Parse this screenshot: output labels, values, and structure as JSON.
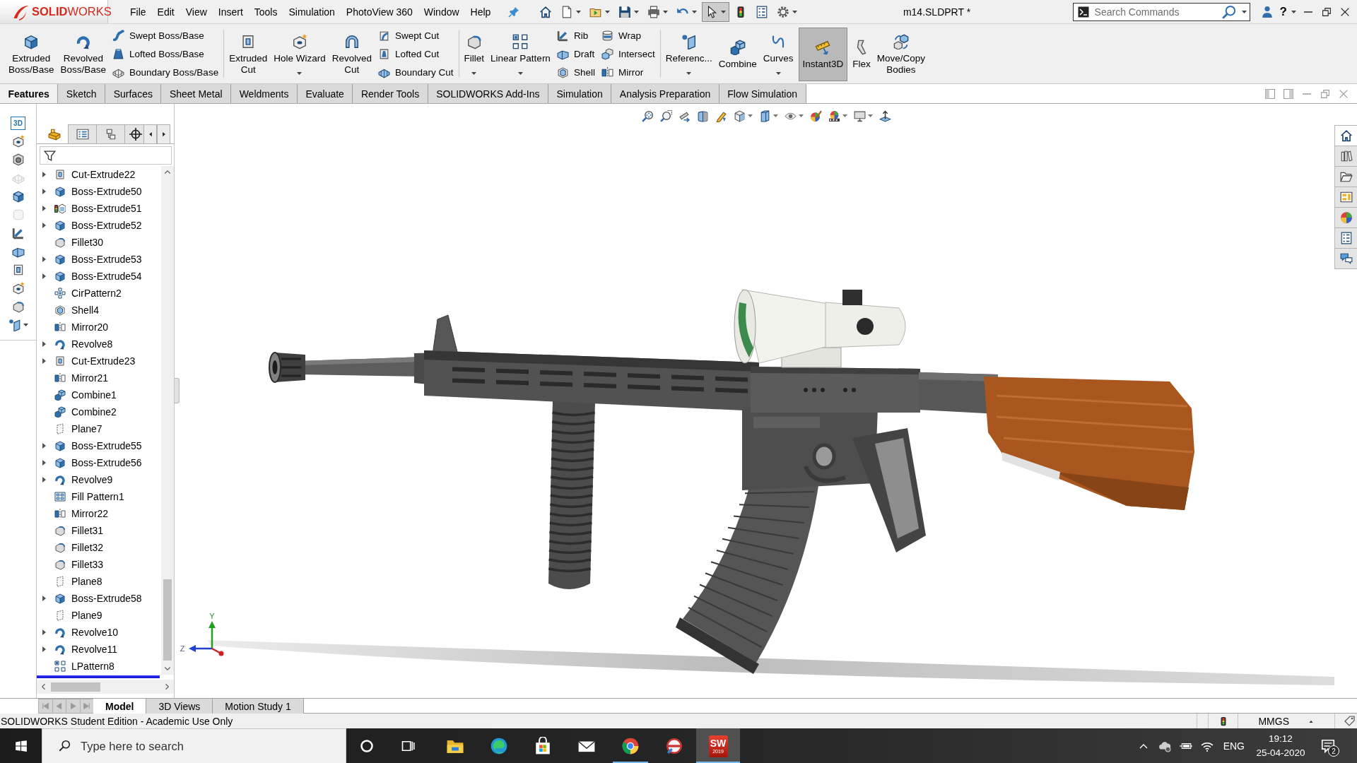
{
  "title_bar": {
    "logo": "**SOLID**WORKS",
    "menu": [
      "File",
      "Edit",
      "View",
      "Insert",
      "Tools",
      "Simulation",
      "PhotoView 360",
      "Window",
      "Help"
    ],
    "quick_access": [
      {
        "dropdown": false,
        "pressed": false
      },
      {
        "dropdown": true,
        "pressed": false
      },
      {
        "dropdown": true,
        "pressed": false
      },
      {
        "dropdown": true,
        "pressed": false
      },
      {
        "dropdown": true,
        "pressed": false
      },
      {
        "dropdown": true,
        "pressed": false
      },
      {
        "dropdown": true,
        "pressed": true
      },
      {
        "dropdown": false,
        "pressed": false
      },
      {
        "dropdown": false,
        "pressed": false
      },
      {
        "dropdown": true,
        "pressed": false
      }
    ],
    "document_title": "m14.SLDPRT *",
    "search": {
      "placeholder": "Search Commands"
    },
    "help": "?"
  },
  "ribbon": {
    "groups": [
      [
        {
          "kind": "large",
          "label": "Extruded Boss/Base",
          "dropdown": false,
          "pressed": false
        },
        {
          "kind": "large",
          "label": "Revolved Boss/Base",
          "dropdown": false,
          "pressed": false
        },
        {
          "kind": "stack",
          "items": [
            "Swept Boss/Base",
            "Lofted Boss/Base",
            "Boundary Boss/Base"
          ]
        }
      ],
      [
        {
          "kind": "large",
          "label": "Extruded Cut",
          "dropdown": false,
          "pressed": false
        },
        {
          "kind": "large",
          "label": "Hole Wizard",
          "dropdown": true,
          "pressed": false
        },
        {
          "kind": "large",
          "label": "Revolved Cut",
          "dropdown": false,
          "pressed": false
        },
        {
          "kind": "stack",
          "items": [
            "Swept Cut",
            "Lofted Cut",
            "Boundary Cut"
          ]
        }
      ],
      [
        {
          "kind": "large",
          "label": "Fillet",
          "dropdown": true,
          "pressed": false
        },
        {
          "kind": "large",
          "label": "Linear Pattern",
          "dropdown": true,
          "pressed": false
        },
        {
          "kind": "stack",
          "items": [
            "Rib",
            "Draft",
            "Shell"
          ]
        },
        {
          "kind": "stack",
          "items": [
            "Wrap",
            "Intersect",
            "Mirror"
          ]
        }
      ],
      [
        {
          "kind": "large",
          "label": "Referenc...",
          "dropdown": true,
          "pressed": false
        },
        {
          "kind": "large",
          "label": "Combine",
          "dropdown": false,
          "pressed": false
        },
        {
          "kind": "large",
          "label": "Curves",
          "dropdown": true,
          "pressed": false
        },
        {
          "kind": "large",
          "label": "Instant3D",
          "dropdown": false,
          "pressed": true
        },
        {
          "kind": "large",
          "label": "Flex",
          "dropdown": false,
          "pressed": false
        },
        {
          "kind": "large",
          "label": "Move/Copy Bodies",
          "dropdown": false,
          "pressed": false
        }
      ]
    ]
  },
  "command_tabs": [
    {
      "label": "Features",
      "selected": true
    },
    {
      "label": "Sketch",
      "selected": false
    },
    {
      "label": "Surfaces",
      "selected": false
    },
    {
      "label": "Sheet Metal",
      "selected": false
    },
    {
      "label": "Weldments",
      "selected": false
    },
    {
      "label": "Evaluate",
      "selected": false
    },
    {
      "label": "Render Tools",
      "selected": false
    },
    {
      "label": "SOLIDWORKS Add-Ins",
      "selected": false
    },
    {
      "label": "Simulation",
      "selected": false
    },
    {
      "label": "Analysis Preparation",
      "selected": false
    },
    {
      "label": "Flow Simulation",
      "selected": false
    }
  ],
  "left_toolbar": [
    {
      "label": "3D",
      "disabled": false,
      "dropdown": false
    },
    {
      "disabled": false,
      "dropdown": false
    },
    {
      "disabled": false,
      "dropdown": false
    },
    {
      "disabled": true,
      "dropdown": false
    },
    {
      "disabled": false,
      "dropdown": false
    },
    {
      "disabled": true,
      "dropdown": false
    },
    {
      "disabled": false,
      "dropdown": false
    },
    {
      "disabled": false,
      "dropdown": false
    },
    {
      "disabled": false,
      "dropdown": false
    },
    {
      "disabled": false,
      "dropdown": false
    },
    {
      "disabled": false,
      "dropdown": false
    },
    {
      "disabled": false,
      "dropdown": true
    }
  ],
  "feature_manager": {
    "tabs": [
      {
        "selected": true
      },
      {
        "selected": false
      },
      {
        "selected": false
      },
      {
        "selected": false
      }
    ],
    "items": [
      {
        "label": "Cut-Extrude22",
        "kind": "cut",
        "expandable": true
      },
      {
        "label": "Boss-Extrude50",
        "kind": "boss",
        "expandable": true
      },
      {
        "label": "Boss-Extrude51",
        "kind": "flagged",
        "expandable": true
      },
      {
        "label": "Boss-Extrude52",
        "kind": "boss",
        "expandable": true
      },
      {
        "label": "Fillet30",
        "kind": "fillet",
        "expandable": false
      },
      {
        "label": "Boss-Extrude53",
        "kind": "boss",
        "expandable": true
      },
      {
        "label": "Boss-Extrude54",
        "kind": "boss",
        "expandable": true
      },
      {
        "label": "CirPattern2",
        "kind": "circular",
        "expandable": false
      },
      {
        "label": "Shell4",
        "kind": "shell",
        "expandable": false
      },
      {
        "label": "Mirror20",
        "kind": "mirror",
        "expandable": false
      },
      {
        "label": "Revolve8",
        "kind": "revolve",
        "expandable": true
      },
      {
        "label": "Cut-Extrude23",
        "kind": "cut",
        "expandable": true
      },
      {
        "label": "Mirror21",
        "kind": "mirror",
        "expandable": false
      },
      {
        "label": "Combine1",
        "kind": "combine",
        "expandable": false
      },
      {
        "label": "Combine2",
        "kind": "combine",
        "expandable": false
      },
      {
        "label": "Plane7",
        "kind": "plane",
        "expandable": false
      },
      {
        "label": "Boss-Extrude55",
        "kind": "boss",
        "expandable": true
      },
      {
        "label": "Boss-Extrude56",
        "kind": "boss",
        "expandable": true
      },
      {
        "label": "Revolve9",
        "kind": "revolve",
        "expandable": true
      },
      {
        "label": "Fill Pattern1",
        "kind": "fill",
        "expandable": false
      },
      {
        "label": "Mirror22",
        "kind": "mirror",
        "expandable": false
      },
      {
        "label": "Fillet31",
        "kind": "fillet",
        "expandable": false
      },
      {
        "label": "Fillet32",
        "kind": "fillet",
        "expandable": false
      },
      {
        "label": "Fillet33",
        "kind": "fillet",
        "expandable": false
      },
      {
        "label": "Plane8",
        "kind": "plane",
        "expandable": false
      },
      {
        "label": "Boss-Extrude58",
        "kind": "boss",
        "expandable": true
      },
      {
        "label": "Plane9",
        "kind": "plane",
        "expandable": false
      },
      {
        "label": "Revolve10",
        "kind": "revolve",
        "expandable": true
      },
      {
        "label": "Revolve11",
        "kind": "revolve",
        "expandable": true
      },
      {
        "label": "LPattern8",
        "kind": "linear",
        "expandable": false
      }
    ]
  },
  "viewport": {
    "view_toolbar": [
      {
        "dropdown": false
      },
      {
        "dropdown": false
      },
      {
        "dropdown": false
      },
      {
        "dropdown": false
      },
      {
        "dropdown": false
      },
      {
        "dropdown": true
      },
      {
        "dropdown": true
      },
      {
        "dropdown": true
      },
      {
        "dropdown": false
      },
      {
        "dropdown": true
      },
      {
        "dropdown": true
      },
      {
        "dropdown": false
      }
    ],
    "task_pane": [
      {
        "selected": true
      },
      {
        "selected": false
      },
      {
        "selected": false
      },
      {
        "selected": false
      },
      {
        "selected": false
      },
      {
        "selected": false
      },
      {
        "selected": false
      }
    ],
    "triad": {
      "y_label": "Y",
      "z_label": "Z"
    }
  },
  "document_tabs": [
    {
      "label": "Model",
      "selected": true
    },
    {
      "label": "3D Views",
      "selected": false
    },
    {
      "label": "Motion Study 1",
      "selected": false
    }
  ],
  "status_bar": {
    "message": "SOLIDWORKS Student Edition - Academic Use Only",
    "units": "MMGS"
  },
  "taskbar": {
    "search": {
      "placeholder": "Type here to search"
    },
    "apps": [
      {
        "running": false,
        "active": false
      },
      {
        "running": false,
        "active": false
      },
      {
        "running": false,
        "active": false
      },
      {
        "running": false,
        "active": false
      },
      {
        "running": true,
        "active": false
      },
      {
        "running": false,
        "active": false
      },
      {
        "running": true,
        "active": true,
        "logo_text": "SW",
        "logo_year": "2019"
      }
    ],
    "language": "ENG",
    "time": "19:12",
    "date": "25-04-2020",
    "notifications": "2"
  }
}
